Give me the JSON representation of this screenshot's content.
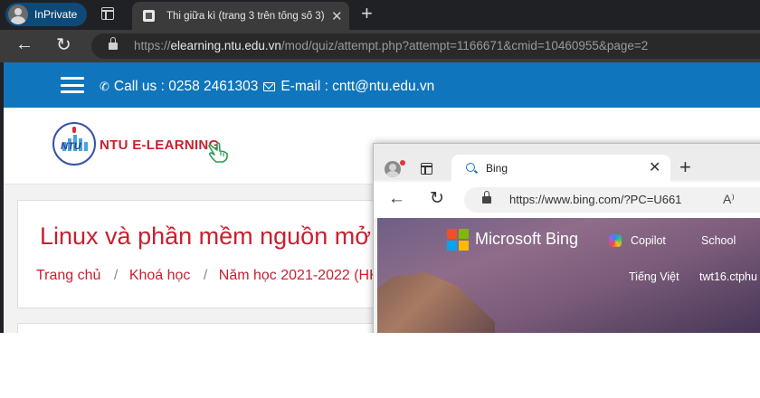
{
  "browser": {
    "profile_label": "InPrivate",
    "tab_title": "Thi giữa kì (trang 3 trên tổng số 3)",
    "tab_close": "✕",
    "new_tab": "+",
    "back": "←",
    "reload": "↻",
    "url_prefix": "https://",
    "url_host": "elearning.ntu.edu.vn",
    "url_path": "/mod/quiz/attempt.php?attempt=1166671&cmid=10460955&page=2"
  },
  "site": {
    "call_text": "Call us : 0258 2461303",
    "email_text": "E-mail : cntt@ntu.edu.vn",
    "logo_text": "NTU E-LEARNING",
    "logo_mark_text": "NTU",
    "course_title": "Linux và phần mềm nguồn mở",
    "breadcrumb": [
      "Trang chủ",
      "Khoá học",
      "Năm học 2021-2022 (HK2)"
    ],
    "breadcrumb_sep": "/"
  },
  "bing_window": {
    "tab_title": "Bing",
    "tab_close": "✕",
    "new_tab": "+",
    "back": "←",
    "reload": "↻",
    "url": "https://www.bing.com/?PC=U661",
    "read_aloud": "A⁾",
    "brand": "Microsoft Bing",
    "nav": [
      "Copilot",
      "School"
    ],
    "language": "Tiếng Việt",
    "user": "twt16.ctphu"
  },
  "colors": {
    "topbar": "#0f75bc",
    "brand_red": "#c8202f",
    "ms_red": "#f25022",
    "ms_green": "#7fba00",
    "ms_blue": "#00a4ef",
    "ms_yellow": "#ffb900"
  }
}
